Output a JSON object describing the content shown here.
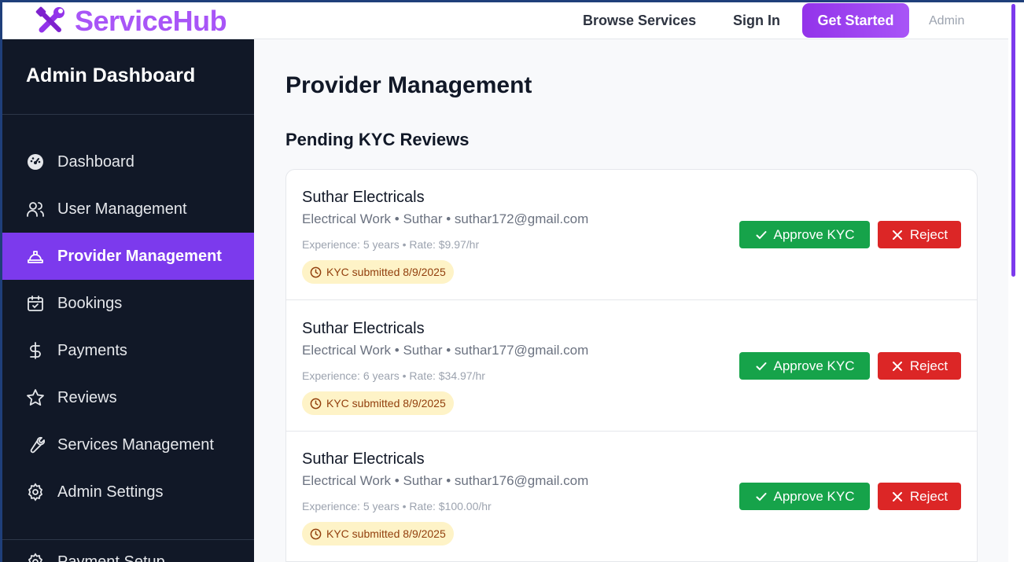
{
  "header": {
    "brand": "ServiceHub",
    "nav": {
      "browse": "Browse Services",
      "signin": "Sign In",
      "get_started": "Get Started",
      "admin": "Admin"
    }
  },
  "sidebar": {
    "title": "Admin Dashboard",
    "items": [
      {
        "label": "Dashboard",
        "icon": "gauge-icon"
      },
      {
        "label": "User Management",
        "icon": "users-icon"
      },
      {
        "label": "Provider Management",
        "icon": "hard-hat-icon",
        "active": true
      },
      {
        "label": "Bookings",
        "icon": "calendar-check-icon"
      },
      {
        "label": "Payments",
        "icon": "dollar-icon"
      },
      {
        "label": "Reviews",
        "icon": "star-icon"
      },
      {
        "label": "Services Management",
        "icon": "wrench-icon"
      },
      {
        "label": "Admin Settings",
        "icon": "gear-icon"
      },
      {
        "label": "Payment Setup",
        "icon": "gear-icon"
      }
    ]
  },
  "main": {
    "page_title": "Provider Management",
    "section_title": "Pending KYC Reviews",
    "approve_label": "Approve KYC",
    "reject_label": "Reject",
    "cards": [
      {
        "name": "Suthar Electricals",
        "meta": "Electrical Work • Suthar • suthar172@gmail.com",
        "details": "Experience: 5 years • Rate: $9.97/hr",
        "badge": "KYC submitted 8/9/2025"
      },
      {
        "name": "Suthar Electricals",
        "meta": "Electrical Work • Suthar • suthar177@gmail.com",
        "details": "Experience: 6 years • Rate: $34.97/hr",
        "badge": "KYC submitted 8/9/2025"
      },
      {
        "name": "Suthar Electricals",
        "meta": "Electrical Work • Suthar • suthar176@gmail.com",
        "details": "Experience: 5 years • Rate: $100.00/hr",
        "badge": "KYC submitted 8/9/2025"
      }
    ]
  },
  "colors": {
    "brand": "#a855f7",
    "sidebar_bg": "#111827",
    "active": "#7c3aed",
    "approve": "#16a34a",
    "reject": "#dc2626",
    "badge_bg": "#fef3c7"
  }
}
